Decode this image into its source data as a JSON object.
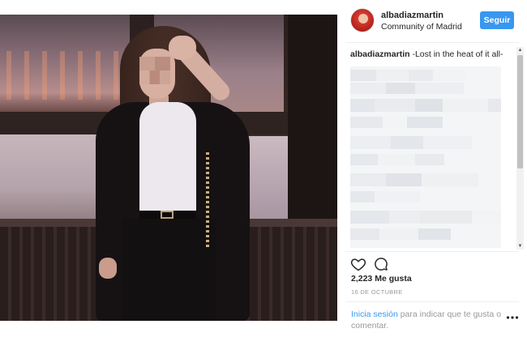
{
  "post": {
    "username": "albadiazmartin",
    "location": "Community of Madrid",
    "follow_label": "Seguir",
    "caption_user": "albadiazmartin",
    "caption_text": " -Lost in the heat of it all-",
    "likes": "2,223 Me gusta",
    "date": "16 DE OCTUBRE",
    "login_link": "Inicia sesión",
    "login_text": " para indicar que te gusta o comentar."
  },
  "icons": {
    "like": "heart-icon",
    "comment": "comment-icon",
    "more": "more-options-icon"
  },
  "colors": {
    "accent": "#3897f0",
    "text": "#262626",
    "muted": "#999999"
  }
}
